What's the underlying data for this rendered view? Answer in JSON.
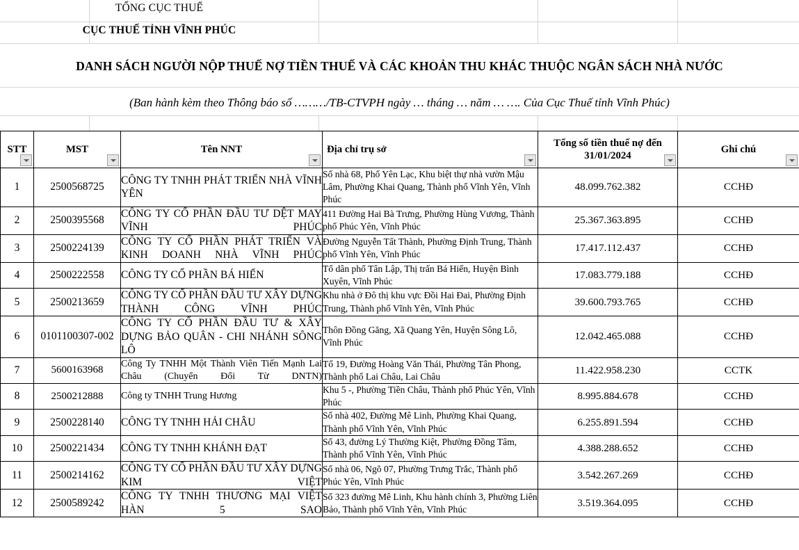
{
  "header": {
    "org_top": "TỔNG CỤC THUẾ",
    "org_name": "CỤC THUẾ TỈNH VĨNH PHÚC",
    "title": "DANH SÁCH NGƯỜI NỘP THUẾ NỢ TIỀN THUẾ VÀ CÁC KHOẢN THU KHÁC THUỘC NGÂN SÁCH NHÀ NƯỚC",
    "subtitle": "(Ban hành kèm theo Thông báo số ………/TB-CTVPH ngày … tháng … năm … ….  Của Cục Thuế tỉnh Vĩnh Phúc)"
  },
  "table": {
    "columns": [
      {
        "label": "STT",
        "filter": true
      },
      {
        "label": "MST",
        "filter": true
      },
      {
        "label": "Tên NNT",
        "filter": true
      },
      {
        "label": "Địa chỉ trụ sở",
        "filter": true
      },
      {
        "label": "Tổng số tiền thuế nợ đến 31/01/2024",
        "filter": true
      },
      {
        "label": "Ghi chú",
        "filter": true
      }
    ],
    "rows": [
      {
        "stt": "1",
        "mst": "2500568725",
        "name": "CÔNG TY TNHH PHÁT TRIỂN NHÀ VĨNH YÊN",
        "address": "Số nhà 68, Phố Yên Lạc, Khu biệt thự nhà vườn Mậu Lâm, Phường Khai Quang, Thành phố Vĩnh Yên, Vĩnh Phúc",
        "amount": "48.099.762.382",
        "note": "CCHĐ"
      },
      {
        "stt": "2",
        "mst": "2500395568",
        "name": "CÔNG TY CỔ PHẦN ĐẦU TƯ DỆT MAY VĨNH PHÚC",
        "address": "411 Đường Hai Bà Trưng, Phường Hùng Vương, Thành phố Phúc Yên, Vĩnh Phúc",
        "amount": "25.367.363.895",
        "note": "CCHĐ"
      },
      {
        "stt": "3",
        "mst": "2500224139",
        "name": "CÔNG TY CỔ PHẦN PHÁT TRIỂN VÀ KINH DOANH NHÀ VĨNH PHÚC",
        "address": "Đường Nguyễn Tất Thành, Phường Định Trung, Thành phố Vĩnh Yên, Vĩnh Phúc",
        "amount": "17.417.112.437",
        "note": "CCHĐ"
      },
      {
        "stt": "4",
        "mst": "2500222558",
        "name": "CÔNG TY CỔ PHẦN BÁ HIẾN",
        "address": "Tổ dân phố Tân Lập, Thị trấn Bá Hiến, Huyện Bình Xuyên, Vĩnh Phúc",
        "amount": "17.083.779.188",
        "note": "CCHĐ"
      },
      {
        "stt": "5",
        "mst": "2500213659",
        "name": "CÔNG TY CỔ PHẦN ĐẦU TƯ XÂY DỰNG THÀNH CÔNG VĨNH PHÚC",
        "address": "Khu nhà ở Đô thị khu vực Đồi Hai Đai, Phường Định Trung, Thành phố Vĩnh Yên, Vĩnh Phúc",
        "amount": "39.600.793.765",
        "note": "CCHĐ"
      },
      {
        "stt": "6",
        "mst": "0101100307-002",
        "name": "CÔNG TY CỔ PHẦN ĐẦU TƯ & XÂY DỰNG BẢO QUÂN - CHI NHÁNH SÔNG LÔ",
        "address": "Thôn Đồng Găng, Xã Quang Yên, Huyện Sông Lô, Vĩnh Phúc",
        "amount": "12.042.465.088",
        "note": "CCHĐ"
      },
      {
        "stt": "7",
        "mst": "5600163968",
        "name": "Công Ty TNHH Một Thành Viên Tiến Mạnh Lai Châu (Chuyển Đổi Từ DNTN)",
        "address": "Tổ 19, Đường Hoàng Văn Thái, Phường Tân Phong, Thành phố Lai Châu, Lai Châu",
        "amount": "11.422.958.230",
        "note": "CCTK"
      },
      {
        "stt": "8",
        "mst": "2500212888",
        "name": "Công ty TNHH Trung Hương",
        "address": "Khu 5 -, Phường Tiền Châu, Thành phố Phúc Yên, Vĩnh Phúc",
        "amount": "8.995.884.678",
        "note": "CCHĐ"
      },
      {
        "stt": "9",
        "mst": "2500228140",
        "name": "CÔNG TY TNHH HẢI CHÂU",
        "address": "Số nhà 402, Đường Mê Linh, Phường Khai Quang, Thành phố Vĩnh Yên, Vĩnh Phúc",
        "amount": "6.255.891.594",
        "note": "CCHĐ"
      },
      {
        "stt": "10",
        "mst": "2500221434",
        "name": "CÔNG TY TNHH KHÁNH ĐẠT",
        "address": "Số 43, đường Lý Thường Kiệt, Phường Đồng Tâm, Thành phố Vĩnh Yên, Vĩnh Phúc",
        "amount": "4.388.288.652",
        "note": "CCHĐ"
      },
      {
        "stt": "11",
        "mst": "2500214162",
        "name": "CÔNG TY CỔ PHẦN ĐẦU TƯ XÂY DỰNG KIM VIỆT",
        "address": "Số nhà 06, Ngõ 07, Phường Trưng Trắc, Thành phố Phúc Yên, Vĩnh Phúc",
        "amount": "3.542.267.269",
        "note": "CCHĐ"
      },
      {
        "stt": "12",
        "mst": "2500589242",
        "name": "CÔNG TY TNHH THƯƠNG MẠI VIỆT HÀN 5 SAO",
        "address": "Số 323 đường Mê Linh, Khu hành chính 3, Phường Liên Bảo, Thành phố Vĩnh Yên, Vĩnh Phúc",
        "amount": "3.519.364.095",
        "note": "CCHĐ"
      }
    ]
  },
  "colors": {
    "grid_light": "#d4d4d4",
    "grid_dark": "#000000",
    "filter_button_bg": "#e6e6e6",
    "filter_button_border": "#a0a0a0",
    "filter_arrow": "#5a5a5a"
  }
}
